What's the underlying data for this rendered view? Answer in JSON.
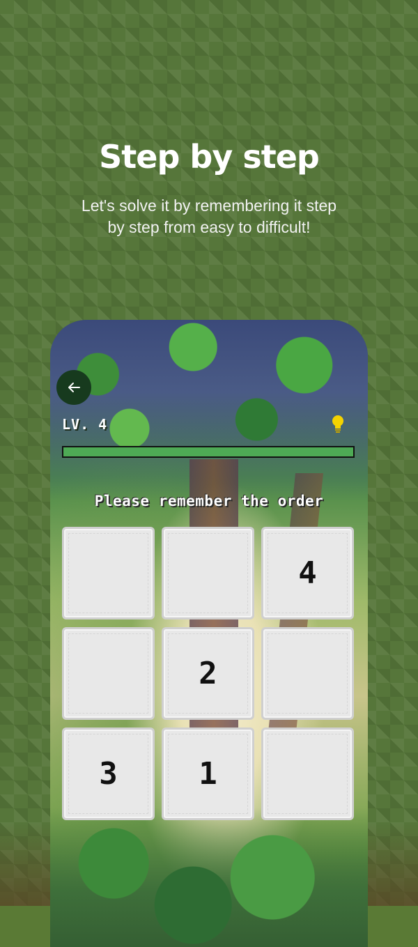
{
  "headline": "Step by step",
  "subtitle": "Let's solve it by remembering it step by step from easy to difficult!",
  "game": {
    "level_label": "LV. 4",
    "prompt": "Please remember the order",
    "progress": 1.0,
    "icons": {
      "back": "back-arrow-icon",
      "hint": "lightbulb-icon"
    },
    "tiles": [
      "",
      "",
      "4",
      "",
      "2",
      "",
      "3",
      "1",
      ""
    ]
  },
  "colors": {
    "progress_fill": "#4eaa55",
    "tile_bg": "#e8e8e8",
    "hint": "#f5d300"
  }
}
